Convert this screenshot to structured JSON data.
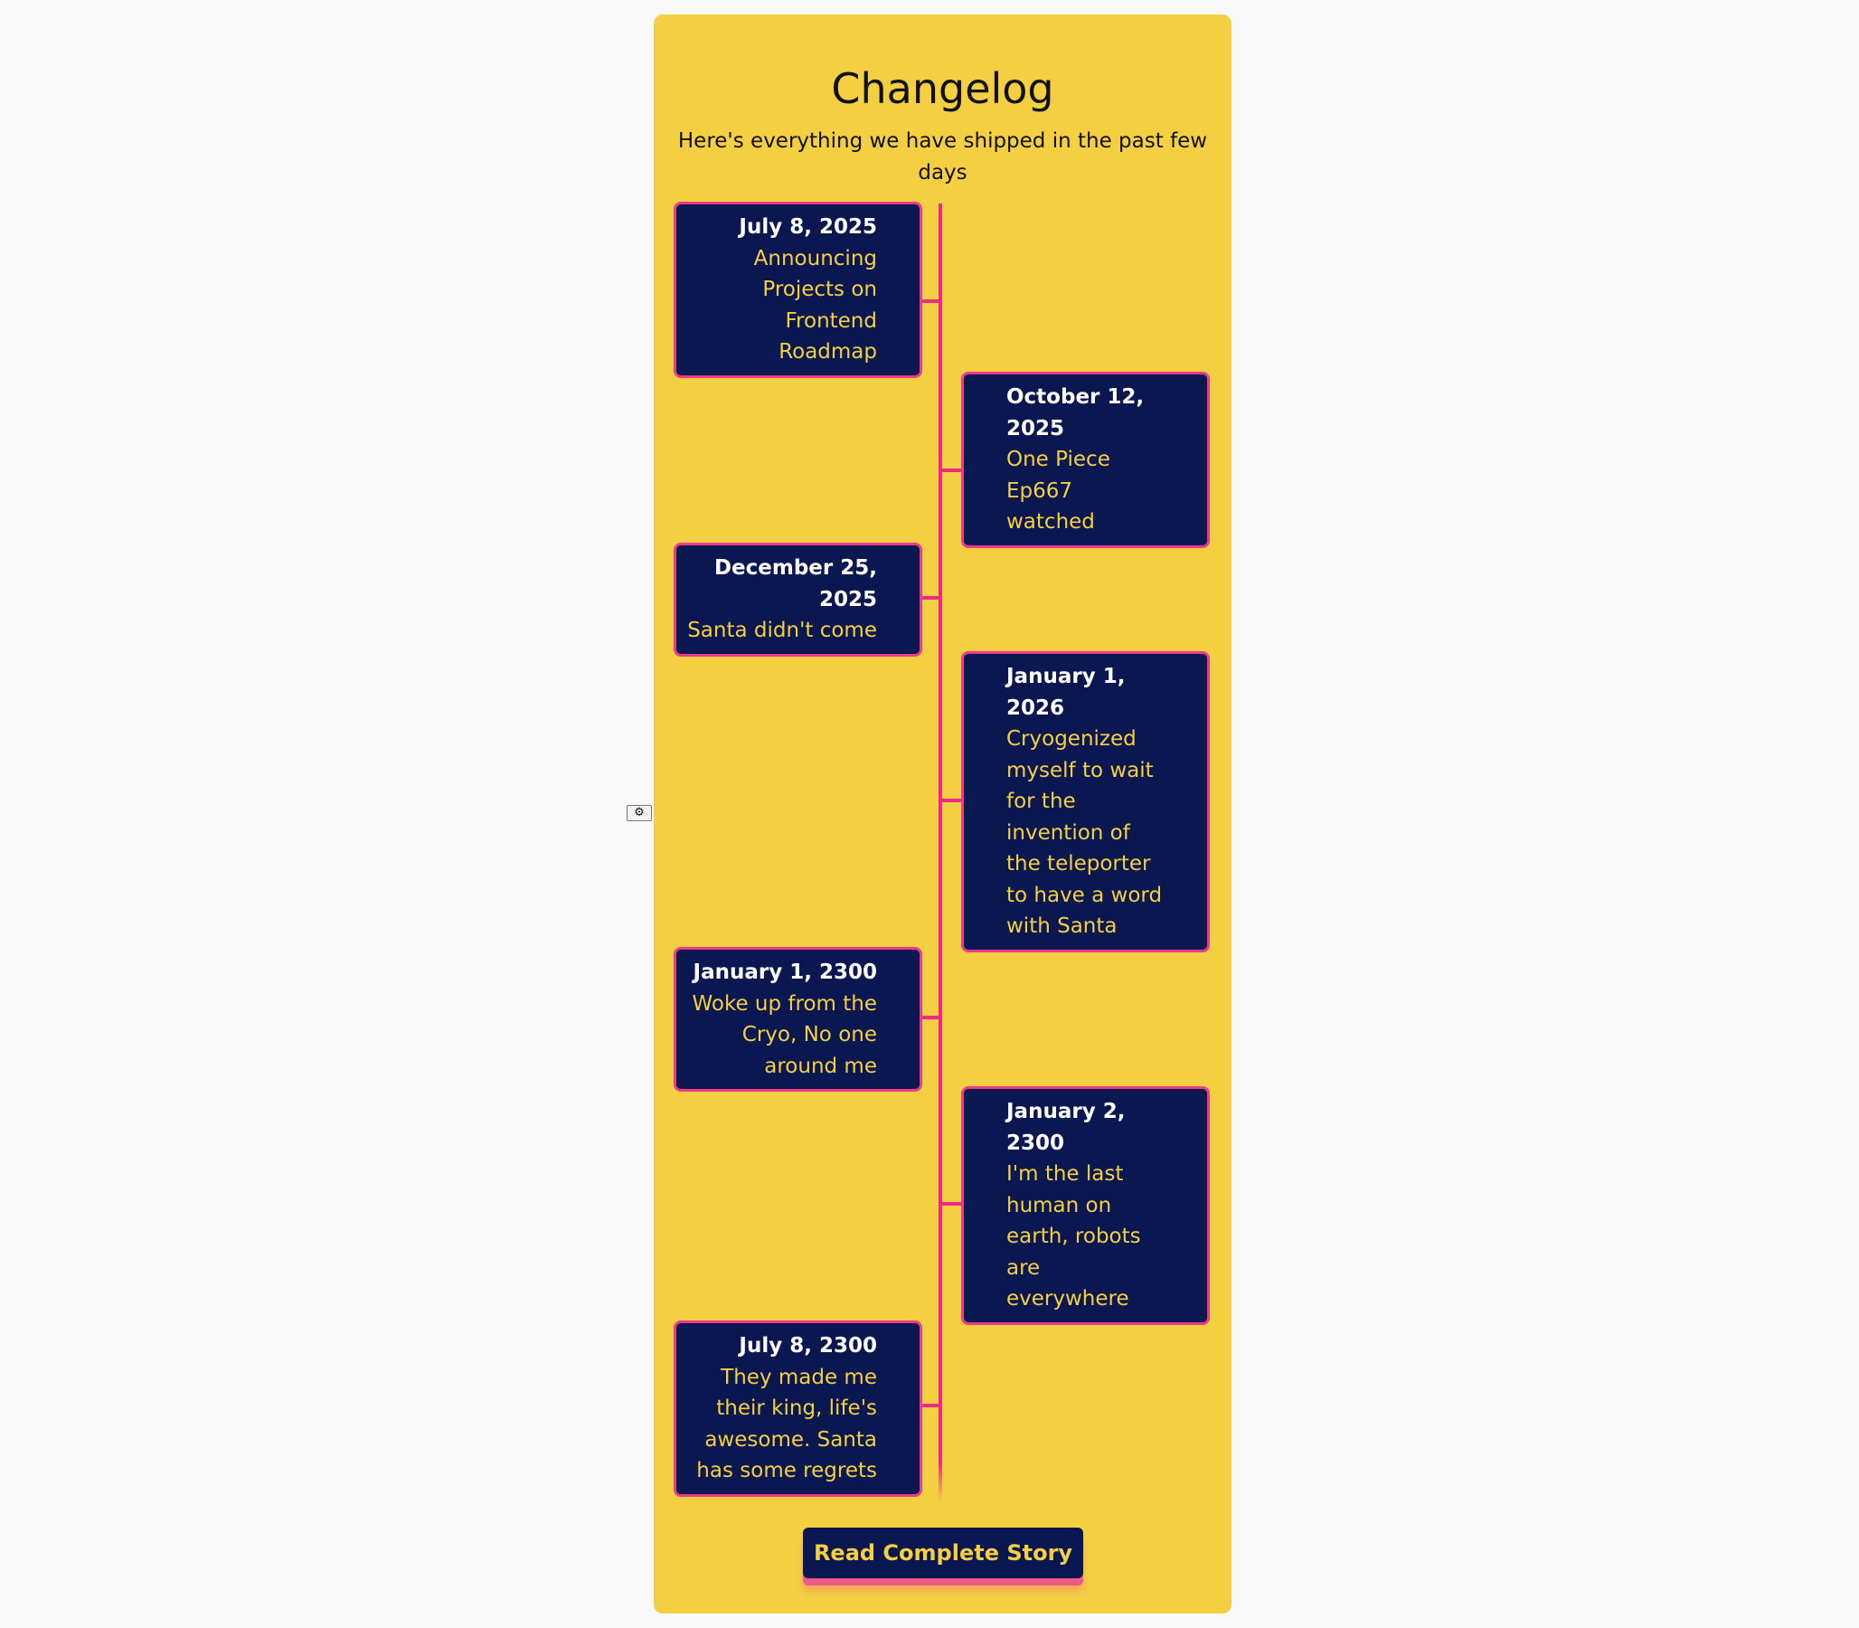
{
  "header": {
    "title": "Changelog",
    "subtitle": "Here's everything we have shipped in the past few days"
  },
  "entries": [
    {
      "date": "July 8, 2025",
      "text": "Announcing Projects on Frontend Roadmap",
      "side": "left"
    },
    {
      "date": "October 12, 2025",
      "text": "One Piece Ep667 watched",
      "side": "right"
    },
    {
      "date": "December 25, 2025",
      "text": "Santa didn't come",
      "side": "left"
    },
    {
      "date": "January 1, 2026",
      "text": "Cryogenized myself to wait for the invention of the teleporter to have a word with Santa",
      "side": "right"
    },
    {
      "date": "January 1, 2300",
      "text": "Woke up from the Cryo, No one around me",
      "side": "left"
    },
    {
      "date": "January 2, 2300",
      "text": "I'm the last human on earth, robots are everywhere",
      "side": "right"
    },
    {
      "date": "July 8, 2300",
      "text": "They made me their king, life's awesome. Santa has some regrets",
      "side": "left"
    }
  ],
  "footer": {
    "button_label": "Read Complete Story"
  },
  "settings": {
    "icon": "gear-icon",
    "glyph": "⚙"
  },
  "colors": {
    "background": "#f9f9f9",
    "card": "#f5cf42",
    "entry_bg": "#0b1751",
    "accent_pink": "#ee2a85",
    "date_text": "#ffffff",
    "entry_text": "#f5cf42"
  }
}
